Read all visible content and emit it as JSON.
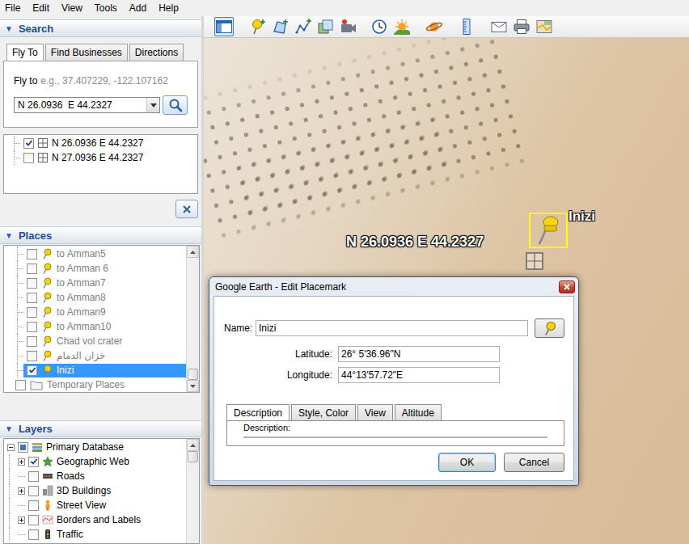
{
  "menu": [
    "File",
    "Edit",
    "View",
    "Tools",
    "Add",
    "Help"
  ],
  "toolbar": [
    {
      "kind": "sidebar",
      "selected": true
    },
    {
      "kind": "placemark",
      "selected": false
    },
    {
      "kind": "polygon",
      "selected": false
    },
    {
      "kind": "path",
      "selected": false
    },
    {
      "kind": "overlay",
      "selected": false
    },
    {
      "kind": "tour",
      "selected": false
    },
    {
      "kind": "history",
      "selected": false
    },
    {
      "kind": "sunlight",
      "selected": false
    },
    {
      "kind": "sky",
      "selected": false
    },
    {
      "kind": "ruler",
      "selected": false
    },
    {
      "kind": "email",
      "selected": false
    },
    {
      "kind": "print",
      "selected": false
    },
    {
      "kind": "maps",
      "selected": false
    }
  ],
  "search": {
    "toggle": "▼",
    "title": "Search",
    "expanded": true,
    "tabs": [
      {
        "label": "Fly To",
        "selected": true
      },
      {
        "label": "Find Businesses",
        "selected": false
      },
      {
        "label": "Directions",
        "selected": false
      }
    ],
    "hint_label": "Fly to",
    "hint_example": "e.g., 37.407229, -122.107162",
    "query": "N 26.0936  E 44.2327",
    "results": [
      {
        "label": "N 26.0936 E 44.2327",
        "checked": true
      },
      {
        "label": "N 27.0936 E 44.2327",
        "checked": false
      }
    ]
  },
  "places": {
    "toggle": "▼",
    "title": "Places",
    "expanded": true,
    "scroll_level": 1,
    "items": [
      {
        "label": "to Amman5",
        "kind": "placemark",
        "checked": false,
        "selected": false
      },
      {
        "label": "to Amman 6",
        "kind": "placemark",
        "checked": false,
        "selected": false
      },
      {
        "label": "to Amman7",
        "kind": "placemark",
        "checked": false,
        "selected": false
      },
      {
        "label": "to Amman8",
        "kind": "placemark",
        "checked": false,
        "selected": false
      },
      {
        "label": "to Amman9",
        "kind": "placemark",
        "checked": false,
        "selected": false
      },
      {
        "label": "to Amman10",
        "kind": "placemark",
        "checked": false,
        "selected": false
      },
      {
        "label": "Chad vol crater",
        "kind": "placemark",
        "checked": false,
        "selected": false
      },
      {
        "label": "خزان الدمام",
        "kind": "placemark",
        "checked": false,
        "selected": false
      },
      {
        "label": "Inizi",
        "kind": "placemark",
        "checked": true,
        "selected": true
      },
      {
        "label": "Temporary Places",
        "kind": "folder",
        "checked": false,
        "selected": false
      }
    ]
  },
  "layers": {
    "toggle": "▼",
    "title": "Layers",
    "expanded": true,
    "scroll_level": 0,
    "root": {
      "label": "Primary Database",
      "kind": "database",
      "checked": true,
      "partial": true,
      "expandable": true,
      "expanded": true,
      "children": [
        {
          "label": "Geographic Web",
          "kind": "web",
          "checked": true,
          "partial": false,
          "expandable": true,
          "expanded": false
        },
        {
          "label": "Roads",
          "kind": "roads",
          "checked": false,
          "partial": false,
          "expandable": false,
          "expanded": false
        },
        {
          "label": "3D Buildings",
          "kind": "buildings",
          "checked": false,
          "partial": false,
          "expandable": true,
          "expanded": false
        },
        {
          "label": "Street View",
          "kind": "streetview",
          "checked": false,
          "partial": false,
          "expandable": false,
          "expanded": false
        },
        {
          "label": "Borders and Labels",
          "kind": "borders",
          "checked": false,
          "partial": false,
          "expandable": true,
          "expanded": false
        },
        {
          "label": "Traffic",
          "kind": "traffic",
          "checked": false,
          "partial": false,
          "expandable": false,
          "expanded": false
        }
      ]
    }
  },
  "map": {
    "search_label": "N 26.0936 E 44.2327",
    "placemark": {
      "label": "Inizi",
      "selected": true
    }
  },
  "dialog": {
    "title": "Google Earth - Edit Placemark",
    "name_label": "Name:",
    "name_value": "Inizi",
    "fields": [
      {
        "label": "Latitude:",
        "value": "26° 5'36.96\"N"
      },
      {
        "label": "Longitude:",
        "value": "44°13'57.72\"E"
      }
    ],
    "tabs": [
      {
        "label": "Description",
        "selected": true
      },
      {
        "label": "Style, Color",
        "selected": false
      },
      {
        "label": "View",
        "selected": false
      },
      {
        "label": "Altitude",
        "selected": false
      }
    ],
    "description_label": "Description:",
    "buttons": [
      {
        "label": "OK",
        "default": true
      },
      {
        "label": "Cancel",
        "default": false
      }
    ]
  }
}
